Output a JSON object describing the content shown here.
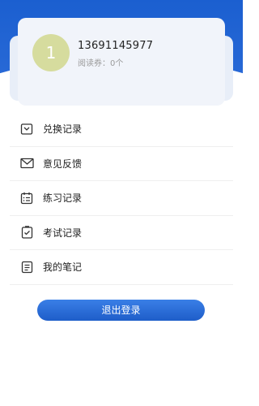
{
  "profile": {
    "avatar_text": "1",
    "phone": "13691145977",
    "voucher": "阅读券：0个"
  },
  "menu": {
    "items": [
      {
        "label": "兑换记录",
        "icon": "exchange-icon"
      },
      {
        "label": "意见反馈",
        "icon": "mail-icon"
      },
      {
        "label": "练习记录",
        "icon": "calendar-list-icon"
      },
      {
        "label": "考试记录",
        "icon": "clipboard-check-icon"
      },
      {
        "label": "我的笔记",
        "icon": "notes-icon"
      }
    ]
  },
  "logout": {
    "label": "退出登录"
  },
  "colors": {
    "primary": "#1b5fd0",
    "avatar": "#d6dc9e"
  }
}
